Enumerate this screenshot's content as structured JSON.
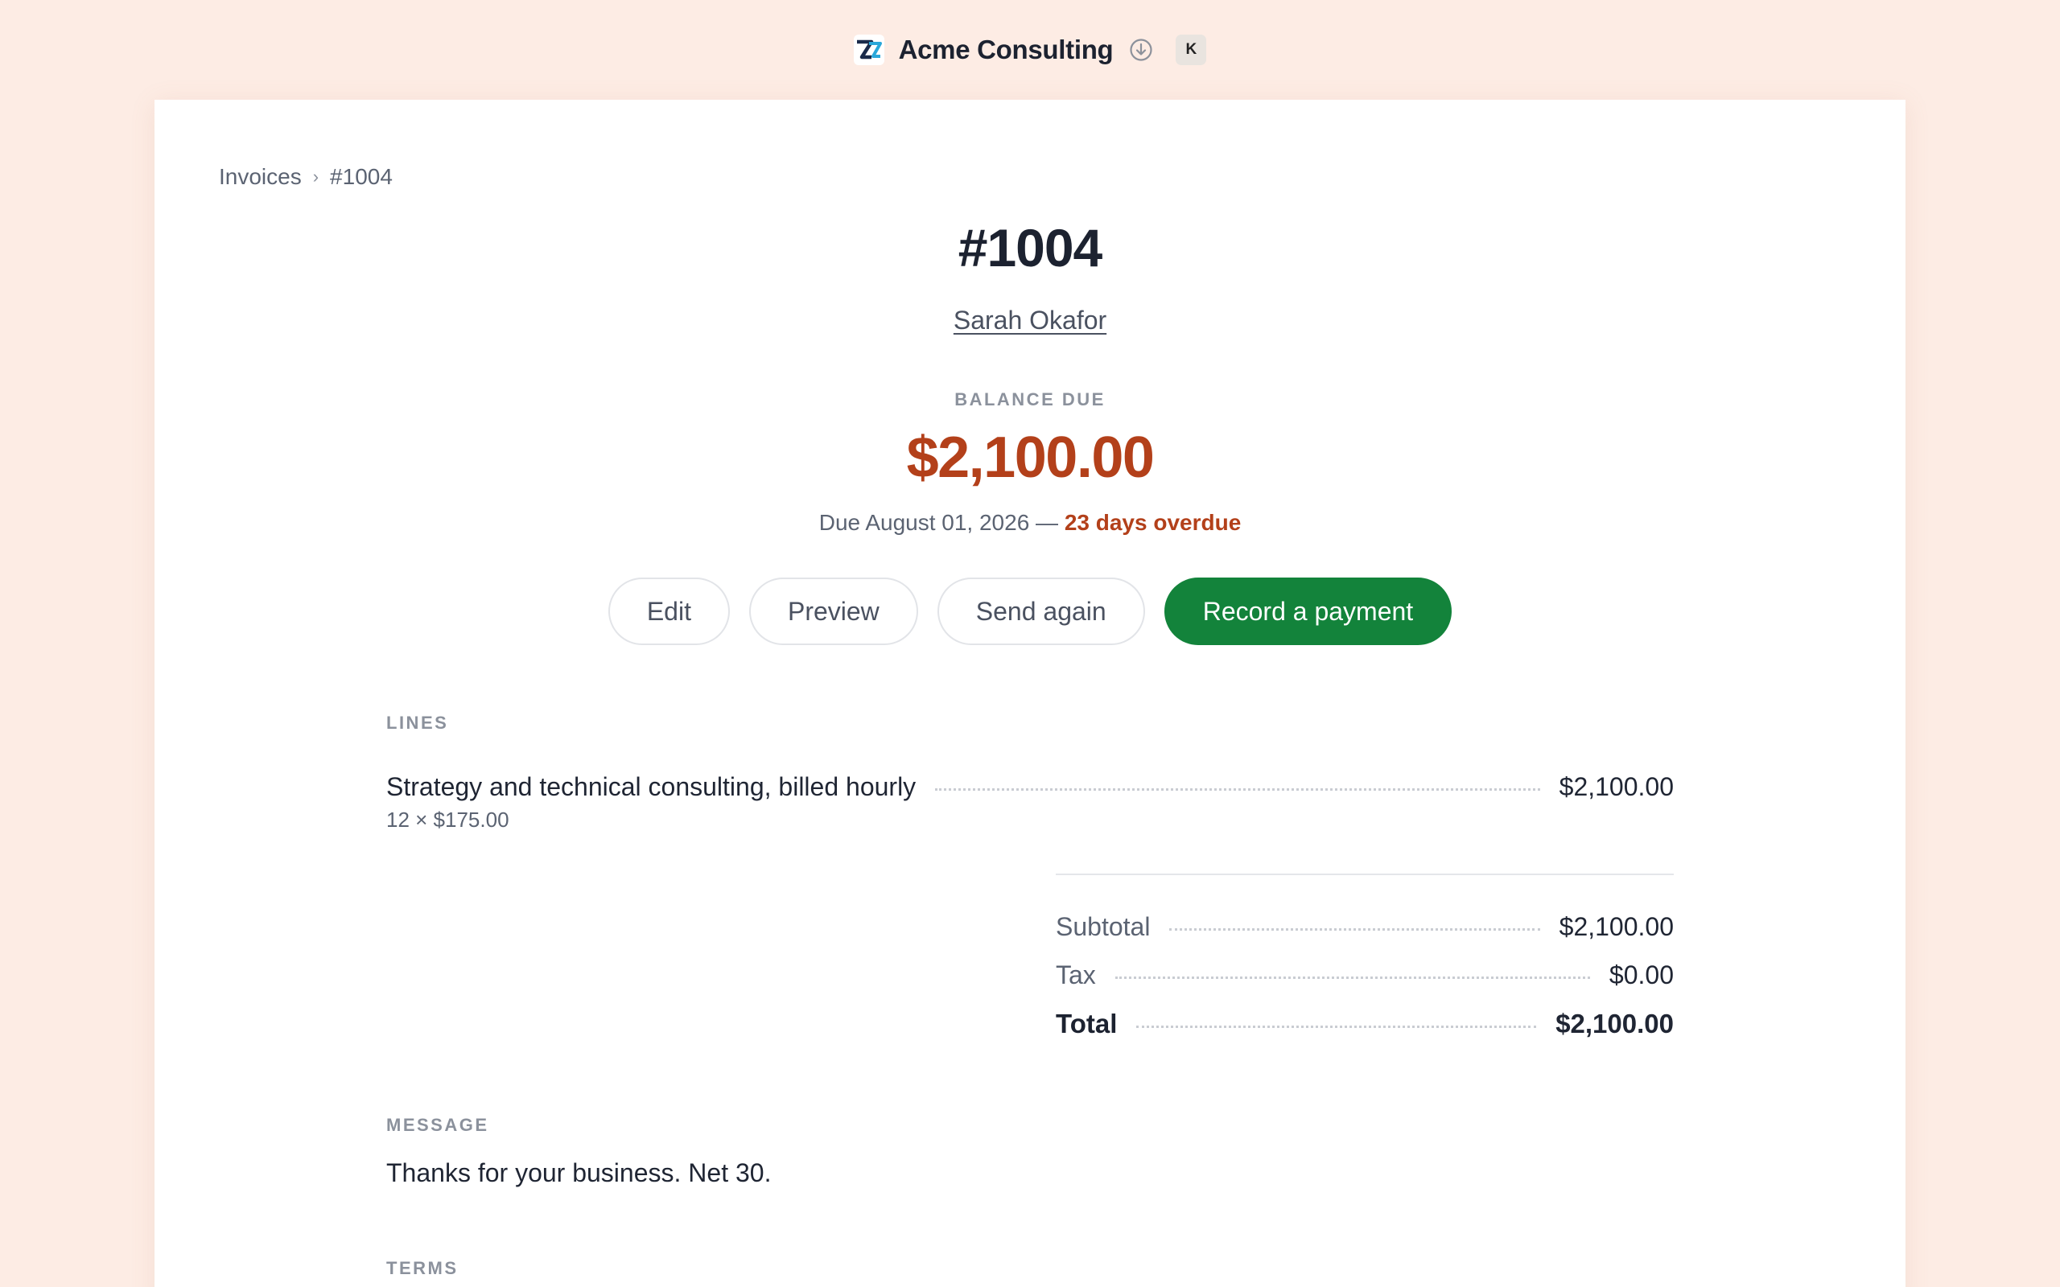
{
  "header": {
    "brand_name": "Acme Consulting",
    "logo_icon": "zed-logo-icon",
    "download_icon": "download-circle-icon",
    "avatar_initial": "K"
  },
  "breadcrumb": {
    "root": "Invoices",
    "separator": "›",
    "current": "#1004"
  },
  "invoice": {
    "number": "#1004",
    "customer": "Sarah Okafor",
    "balance_label": "BALANCE DUE",
    "balance_amount": "$2,100.00",
    "due_text": "Due August 01, 2026 —",
    "overdue_text": "23 days overdue"
  },
  "actions": {
    "edit": "Edit",
    "preview": "Preview",
    "send_again": "Send again",
    "record_payment": "Record a payment"
  },
  "lines": {
    "label": "LINES",
    "items": [
      {
        "description": "Strategy and technical consulting, billed hourly",
        "detail": "12 × $175.00",
        "amount": "$2,100.00"
      }
    ]
  },
  "totals": {
    "subtotal_label": "Subtotal",
    "subtotal_value": "$2,100.00",
    "tax_label": "Tax",
    "tax_value": "$0.00",
    "total_label": "Total",
    "total_value": "$2,100.00"
  },
  "message": {
    "label": "MESSAGE",
    "text": "Thanks for your business. Net 30."
  },
  "terms": {
    "label": "TERMS"
  },
  "colors": {
    "background": "#fdece4",
    "accent_green": "#13833b",
    "overdue_red": "#b3401a"
  }
}
